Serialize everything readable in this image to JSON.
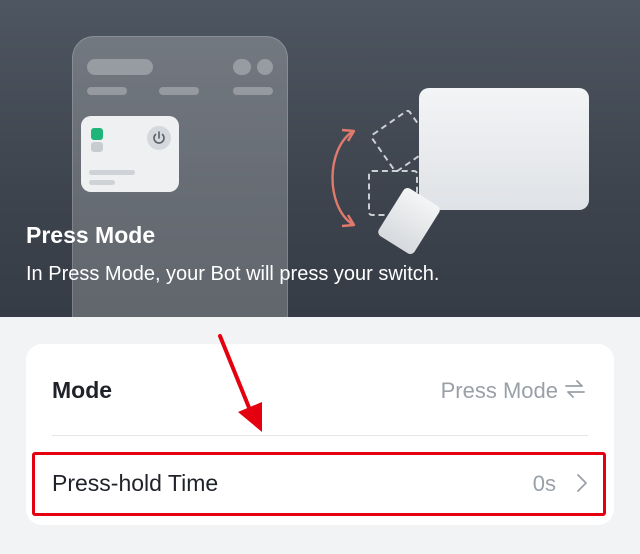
{
  "hero": {
    "title": "Press Mode",
    "description": "In Press Mode, your Bot will press your switch."
  },
  "settings": {
    "mode": {
      "label": "Mode",
      "value": "Press Mode",
      "icon": "swap-arrows-icon"
    },
    "press_hold": {
      "label": "Press-hold Time",
      "value": "0s",
      "icon": "chevron-right-icon"
    }
  },
  "colors": {
    "annotation": "#e5000f",
    "led_on": "#1fb47a",
    "rotate_arrow": "#e07a6c"
  }
}
